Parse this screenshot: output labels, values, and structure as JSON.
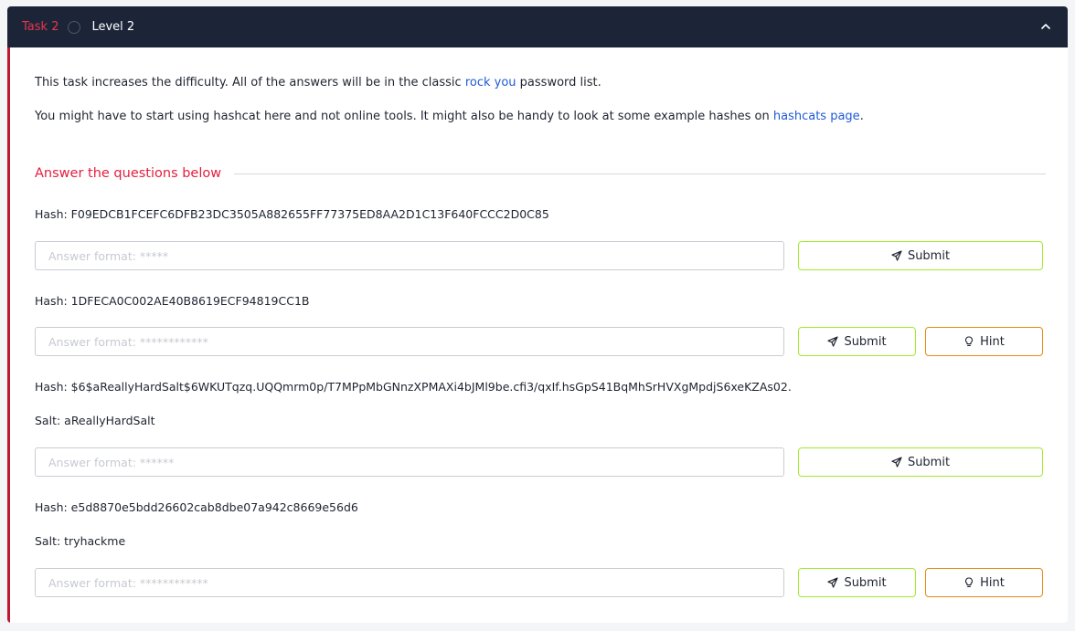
{
  "header": {
    "task_label": "Task 2",
    "title": "Level 2",
    "status_icon": "circle-icon",
    "collapse_icon": "chevron-up-icon",
    "background": "#1c2538",
    "task_color": "#e8364a"
  },
  "intro": {
    "p1_before": "This task increases the difficulty. All of the answers will be in the classic ",
    "p1_link": "rock you",
    "p1_after": " password list.",
    "p2_before": "You might have to start using hashcat here and not online tools. It might also be handy to look at some example hashes on ",
    "p2_link": "hashcats page",
    "p2_after": "."
  },
  "answer_heading": "Answer the questions below",
  "questions": [
    {
      "hash": "Hash: F09EDCB1FCEFC6DFB23DC3505A882655FF77375ED8AA2D1C13F640FCCC2D0C85",
      "placeholder": "Answer format: *****",
      "submit_label": "Submit"
    },
    {
      "hash": "Hash: 1DFECA0C002AE40B8619ECF94819CC1B",
      "placeholder": "Answer format: ************",
      "submit_label": "Submit",
      "hint_label": "Hint"
    },
    {
      "hash": "Hash: $6$aReallyHardSalt$6WKUTqzq.UQQmrm0p/T7MPpMbGNnzXPMAXi4bJMl9be.cfi3/qxIf.hsGpS41BqMhSrHVXgMpdjS6xeKZAs02.",
      "salt": "Salt: aReallyHardSalt",
      "placeholder": "Answer format: ******",
      "submit_label": "Submit"
    },
    {
      "hash": "Hash: e5d8870e5bdd26602cab8dbe07a942c8669e56d6",
      "salt": "Salt: tryhackme",
      "placeholder": "Answer format: ************",
      "submit_label": "Submit",
      "hint_label": "Hint"
    }
  ],
  "icons": {
    "submit": "send-icon",
    "hint": "lightbulb-icon"
  },
  "colors": {
    "accent_red": "#e41e3f",
    "left_bar": "#c11632",
    "link": "#1f5bd6",
    "submit_border": "#a3ea2a",
    "hint_border": "#e88a10"
  }
}
